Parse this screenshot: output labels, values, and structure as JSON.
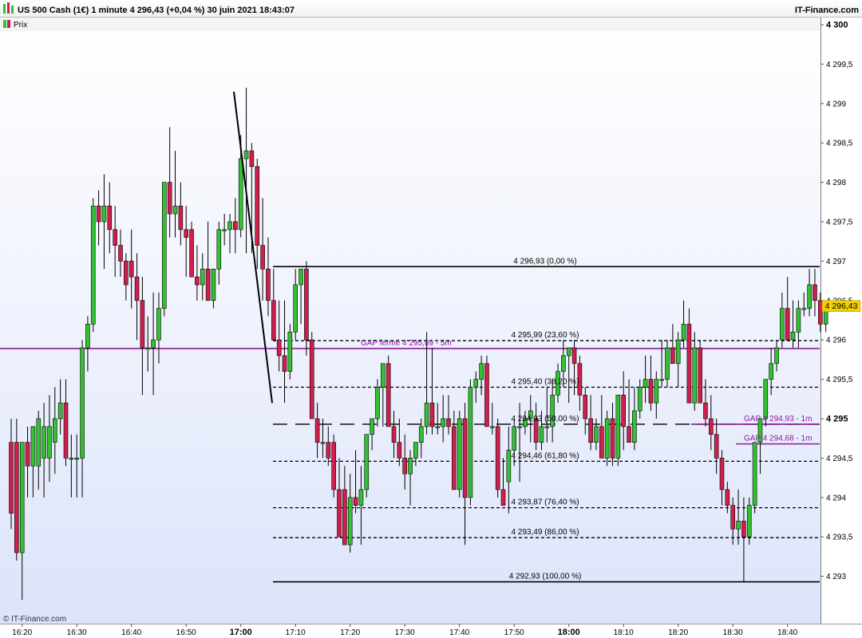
{
  "header": {
    "title": "US 500 Cash (1€) 1 minute 4 296,43 (+0,04 %) 30 juin 2021 18:43:07",
    "brand": "IT-Finance.com",
    "legend_label": "Prix",
    "legend_icon": "candlestick-icon"
  },
  "watermark": "© IT-Finance.com",
  "colors": {
    "up": "#33c133",
    "down": "#d11f4d",
    "gap": "#8a1a9b",
    "fib": "#000000",
    "price_tag": "#f0d000"
  },
  "chart_data": {
    "type": "candlestick",
    "title": "US 500 Cash (1€) 1 minute",
    "y_ticks": [
      "4 293",
      "4 293,5",
      "4 294",
      "4 294,5",
      "4 295",
      "4 295,5",
      "4 296",
      "4 296,5",
      "4 297",
      "4 297,5",
      "4 298",
      "4 298,5",
      "4 299",
      "4 299,5",
      "4 300"
    ],
    "y_major_ticks": [
      "4 295",
      "4 300"
    ],
    "ylim": [
      4292.93,
      4300.3
    ],
    "x_ticks": [
      "16:20",
      "16:30",
      "16:40",
      "16:50",
      "17:00",
      "17:10",
      "17:20",
      "17:30",
      "17:40",
      "17:50",
      "18:00",
      "18:10",
      "18:20",
      "18:30",
      "18:40"
    ],
    "x_major_ticks": [
      "17:00",
      "18:00"
    ],
    "last_price": "4 296,43",
    "series": [
      {
        "start_time": "16:18",
        "interval": "1 minute",
        "ohlc": [
          [
            4294.7,
            4295.0,
            4293.6,
            4293.8
          ],
          [
            4294.7,
            4295.0,
            4293.2,
            4293.3
          ],
          [
            4293.3,
            4294.7,
            4292.7,
            4294.7
          ],
          [
            4294.7,
            4294.9,
            4294.0,
            4294.4
          ],
          [
            4294.4,
            4294.9,
            4294.0,
            4294.9
          ],
          [
            4294.4,
            4295.1,
            4294.1,
            4295.0
          ],
          [
            4294.5,
            4295.2,
            4294.0,
            4294.9
          ],
          [
            4294.5,
            4295.3,
            4294.2,
            4294.9
          ],
          [
            4294.7,
            4295.4,
            4294.3,
            4295.0
          ],
          [
            4295.0,
            4295.5,
            4294.8,
            4295.2
          ],
          [
            4295.2,
            4295.5,
            4294.4,
            4294.5
          ],
          [
            4294.5,
            4294.8,
            4294.0,
            4294.5
          ],
          [
            4294.5,
            4294.8,
            4294.0,
            4294.5
          ],
          [
            4294.5,
            4296.0,
            4294.0,
            4295.9
          ],
          [
            4295.9,
            4296.3,
            4295.6,
            4296.2
          ],
          [
            4296.2,
            4297.8,
            4296.1,
            4297.7
          ],
          [
            4297.7,
            4297.9,
            4297.2,
            4297.5
          ],
          [
            4297.5,
            4298.1,
            4296.9,
            4297.7
          ],
          [
            4297.7,
            4298.0,
            4297.1,
            4297.4
          ],
          [
            4297.4,
            4297.7,
            4296.8,
            4297.2
          ],
          [
            4297.2,
            4297.4,
            4296.8,
            4297.0
          ],
          [
            4297.0,
            4297.1,
            4296.5,
            4296.7
          ],
          [
            4297.0,
            4297.4,
            4296.4,
            4296.8
          ],
          [
            4296.8,
            4297.1,
            4296.0,
            4296.5
          ],
          [
            4296.5,
            4296.8,
            4295.3,
            4295.9
          ],
          [
            4295.9,
            4296.3,
            4295.6,
            4295.9
          ],
          [
            4295.9,
            4296.6,
            4295.3,
            4296.0
          ],
          [
            4296.0,
            4296.6,
            4295.7,
            4296.4
          ],
          [
            4296.4,
            4297.3,
            4296.3,
            4298.0
          ],
          [
            4298.0,
            4298.7,
            4297.3,
            4297.6
          ],
          [
            4297.6,
            4298.4,
            4297.3,
            4297.7
          ],
          [
            4297.7,
            4298.0,
            4297.2,
            4297.4
          ],
          [
            4297.4,
            4297.7,
            4296.8,
            4297.3
          ],
          [
            4297.4,
            4297.5,
            4296.8,
            4296.8
          ],
          [
            4296.8,
            4297.2,
            4296.5,
            4296.7
          ],
          [
            4296.7,
            4297.1,
            4296.5,
            4296.9
          ],
          [
            4296.9,
            4297.5,
            4296.5,
            4296.5
          ],
          [
            4296.5,
            4296.9,
            4296.4,
            4296.9
          ],
          [
            4296.9,
            4297.5,
            4296.7,
            4297.4
          ],
          [
            4297.4,
            4297.6,
            4297.2,
            4297.4
          ],
          [
            4297.4,
            4297.6,
            4297.1,
            4297.5
          ],
          [
            4297.5,
            4297.8,
            4297.1,
            4297.4
          ],
          [
            4297.4,
            4298.6,
            4297.3,
            4298.3
          ],
          [
            4298.3,
            4299.2,
            4297.1,
            4298.4
          ],
          [
            4298.4,
            4298.5,
            4297.1,
            4298.2
          ],
          [
            4298.2,
            4298.3,
            4296.9,
            4297.2
          ],
          [
            4297.2,
            4297.8,
            4296.5,
            4296.9
          ],
          [
            4296.9,
            4297.3,
            4296.3,
            4296.5
          ],
          [
            4296.5,
            4296.9,
            4296.1,
            4296.0
          ],
          [
            4296.0,
            4296.5,
            4295.6,
            4295.8
          ],
          [
            4295.8,
            4296.5,
            4295.2,
            4295.6
          ],
          [
            4295.6,
            4296.2,
            4295.5,
            4296.1
          ],
          [
            4296.1,
            4296.9,
            4296.0,
            4296.7
          ],
          [
            4296.7,
            4296.9,
            4296.2,
            4296.9
          ],
          [
            4296.9,
            4297.0,
            4295.8,
            4296.0
          ],
          [
            4296.0,
            4296.1,
            4295.5,
            4295.0
          ],
          [
            4295.0,
            4295.2,
            4294.5,
            4294.7
          ],
          [
            4294.7,
            4295.0,
            4294.5,
            4294.7
          ],
          [
            4294.7,
            4294.9,
            4294.4,
            4294.5
          ],
          [
            4294.7,
            4294.8,
            4294.0,
            4294.1
          ],
          [
            4294.1,
            4294.5,
            4293.6,
            4293.5
          ],
          [
            4294.1,
            4294.4,
            4293.4,
            4293.4
          ],
          [
            4293.4,
            4294.3,
            4293.3,
            4294.0
          ],
          [
            4294.0,
            4294.6,
            4293.8,
            4293.9
          ],
          [
            4293.9,
            4294.4,
            4293.4,
            4294.1
          ],
          [
            4294.1,
            4294.8,
            4294.0,
            4294.8
          ],
          [
            4294.8,
            4295.0,
            4294.6,
            4295.0
          ],
          [
            4295.0,
            4295.5,
            4294.9,
            4295.4
          ],
          [
            4295.4,
            4295.6,
            4294.9,
            4295.7
          ],
          [
            4295.7,
            4295.8,
            4295.3,
            4294.9
          ],
          [
            4294.9,
            4295.1,
            4294.5,
            4294.7
          ],
          [
            4294.7,
            4295.0,
            4294.4,
            4294.5
          ],
          [
            4294.5,
            4294.8,
            4294.1,
            4294.3
          ],
          [
            4294.3,
            4294.6,
            4293.9,
            4294.5
          ],
          [
            4294.5,
            4294.7,
            4294.4,
            4294.7
          ],
          [
            4294.7,
            4295.0,
            4294.5,
            4294.9
          ],
          [
            4294.9,
            4296.1,
            4294.8,
            4295.2
          ],
          [
            4295.2,
            4295.9,
            4294.8,
            4294.9
          ],
          [
            4294.9,
            4295.2,
            4294.8,
            4294.9
          ],
          [
            4294.9,
            4295.3,
            4294.7,
            4295.0
          ],
          [
            4295.0,
            4295.3,
            4294.8,
            4294.9
          ],
          [
            4294.9,
            4295.1,
            4294.2,
            4294.1
          ],
          [
            4294.1,
            4295.1,
            4294.0,
            4295.0
          ],
          [
            4295.0,
            4295.2,
            4293.4,
            4294.0
          ],
          [
            4294.0,
            4295.5,
            4293.9,
            4295.4
          ],
          [
            4295.4,
            4295.6,
            4295.2,
            4295.5
          ],
          [
            4295.5,
            4295.8,
            4295.3,
            4295.7
          ],
          [
            4295.7,
            4295.8,
            4294.9,
            4294.9
          ],
          [
            4294.9,
            4295.2,
            4294.8,
            4294.9
          ],
          [
            4294.9,
            4295.0,
            4294.0,
            4294.1
          ],
          [
            4294.1,
            4294.5,
            4293.9,
            4293.9
          ],
          [
            4294.2,
            4294.9,
            4293.8,
            4294.6
          ],
          [
            4294.6,
            4295.0,
            4294.4,
            4294.9
          ],
          [
            4294.9,
            4295.2,
            4294.2,
            4294.9
          ],
          [
            4294.9,
            4295.1,
            4294.8,
            4295.0
          ],
          [
            4295.0,
            4295.3,
            4294.7,
            4295.1
          ],
          [
            4295.0,
            4295.2,
            4294.6,
            4294.7
          ],
          [
            4294.7,
            4295.1,
            4294.6,
            4294.9
          ],
          [
            4294.9,
            4295.4,
            4294.7,
            4294.9
          ],
          [
            4294.9,
            4295.5,
            4294.7,
            4295.3
          ],
          [
            4295.3,
            4295.7,
            4295.2,
            4295.6
          ],
          [
            4295.6,
            4296.0,
            4295.4,
            4295.8
          ],
          [
            4295.8,
            4295.9,
            4295.2,
            4295.9
          ],
          [
            4295.9,
            4296.0,
            4295.3,
            4295.7
          ],
          [
            4295.7,
            4295.8,
            4295.1,
            4295.3
          ],
          [
            4295.3,
            4295.4,
            4294.8,
            4295.0
          ],
          [
            4295.0,
            4295.3,
            4294.6,
            4294.7
          ],
          [
            4294.7,
            4295.0,
            4294.6,
            4294.9
          ],
          [
            4294.9,
            4295.3,
            4294.5,
            4294.5
          ],
          [
            4294.5,
            4295.1,
            4294.4,
            4295.0
          ],
          [
            4295.0,
            4295.2,
            4294.4,
            4294.5
          ],
          [
            4294.5,
            4295.3,
            4294.4,
            4295.3
          ],
          [
            4295.3,
            4295.6,
            4294.6,
            4294.9
          ],
          [
            4294.9,
            4295.5,
            4294.7,
            4294.7
          ],
          [
            4294.7,
            4295.4,
            4294.6,
            4295.1
          ],
          [
            4295.1,
            4295.5,
            4295.0,
            4295.4
          ],
          [
            4295.4,
            4295.8,
            4295.2,
            4295.5
          ],
          [
            4295.5,
            4295.8,
            4295.1,
            4295.2
          ],
          [
            4295.2,
            4295.6,
            4295.0,
            4295.5
          ],
          [
            4295.5,
            4296.0,
            4295.4,
            4295.5
          ],
          [
            4295.5,
            4296.0,
            4295.4,
            4295.9
          ],
          [
            4295.9,
            4296.2,
            4295.7,
            4295.7
          ],
          [
            4295.7,
            4296.1,
            4295.4,
            4296.0
          ],
          [
            4296.0,
            4296.5,
            4295.9,
            4296.2
          ],
          [
            4296.2,
            4296.4,
            4295.2,
            4295.2
          ],
          [
            4295.2,
            4296.1,
            4295.1,
            4295.9
          ],
          [
            4295.9,
            4296.0,
            4295.3,
            4295.2
          ],
          [
            4295.2,
            4295.5,
            4294.9,
            4295.0
          ],
          [
            4295.0,
            4295.3,
            4294.6,
            4294.8
          ],
          [
            4294.8,
            4295.0,
            4294.3,
            4294.5
          ],
          [
            4294.5,
            4294.6,
            4293.9,
            4294.1
          ],
          [
            4294.1,
            4294.2,
            4293.8,
            4293.9
          ],
          [
            4293.9,
            4294.0,
            4293.4,
            4293.6
          ],
          [
            4293.6,
            4294.1,
            4293.4,
            4293.7
          ],
          [
            4293.7,
            4294.0,
            4292.93,
            4293.5
          ],
          [
            4293.5,
            4294.0,
            4293.4,
            4293.9
          ],
          [
            4293.9,
            4294.7,
            4293.8,
            4294.7
          ],
          [
            4294.7,
            4294.8,
            4294.3,
            4295.0
          ],
          [
            4295.0,
            4295.5,
            4294.9,
            4295.5
          ],
          [
            4295.5,
            4295.9,
            4295.3,
            4295.7
          ],
          [
            4295.7,
            4296.0,
            4295.6,
            4295.9
          ],
          [
            4296.0,
            4296.6,
            4295.9,
            4296.4
          ],
          [
            4296.4,
            4296.8,
            4296.0,
            4296.0
          ],
          [
            4296.0,
            4296.5,
            4295.9,
            4296.1
          ],
          [
            4296.1,
            4296.5,
            4295.9,
            4296.4
          ],
          [
            4296.4,
            4296.6,
            4296.3,
            4296.4
          ],
          [
            4296.4,
            4296.9,
            4296.3,
            4296.7
          ],
          [
            4296.7,
            4296.9,
            4296.3,
            4296.5
          ],
          [
            4296.5,
            4296.6,
            4296.1,
            4296.2
          ],
          [
            4296.2,
            4296.5,
            4296.1,
            4296.43
          ]
        ]
      }
    ],
    "fibonacci": {
      "levels": [
        {
          "price": 4296.93,
          "label": "4 296,93 (0,00 %)",
          "style": "solid"
        },
        {
          "price": 4295.99,
          "label": "4 295,99 (23,60 %)",
          "style": "dashed"
        },
        {
          "price": 4295.4,
          "label": "4 295,40 (38,20 %)",
          "style": "dashed"
        },
        {
          "price": 4294.93,
          "label": "4 294,93 (50,00 %)",
          "style": "longdash"
        },
        {
          "price": 4294.46,
          "label": "4 294,46 (61,80 %)",
          "style": "dashed"
        },
        {
          "price": 4293.87,
          "label": "4 293,87 (76,40 %)",
          "style": "dashed"
        },
        {
          "price": 4293.49,
          "label": "4 293,49 (86,00 %)",
          "style": "dashed"
        },
        {
          "price": 4292.93,
          "label": "4 292,93 (100,00 %)",
          "style": "solid"
        }
      ],
      "swing_high": 4299.15,
      "swing_low": 4295.2
    },
    "gaps": [
      {
        "price": 4295.89,
        "label": "GAP fermé 4 295,89 - 5m"
      },
      {
        "price": 4294.93,
        "label": "GAP 4 294,93 - 1m"
      },
      {
        "price": 4294.68,
        "label": "GAP 4 294,68 - 1m"
      }
    ]
  }
}
